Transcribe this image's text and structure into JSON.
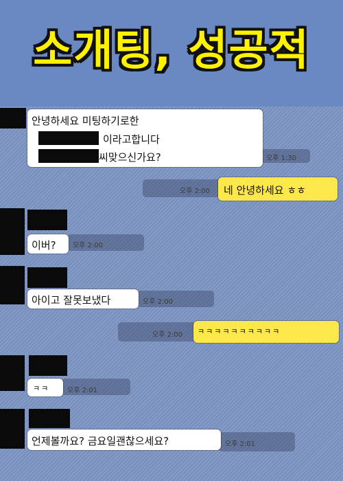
{
  "header": {
    "title": "소개팅, 성공적"
  },
  "messages": [
    {
      "side": "received",
      "lines": [
        "안녕하세요 미팅하기로한",
        "이라고합니다",
        "씨맞으신가요?"
      ],
      "time": "오후 1:30"
    },
    {
      "side": "sent",
      "lines": [
        "네 안녕하세요 ㅎㅎ"
      ],
      "time": "오후 2:00"
    },
    {
      "side": "received",
      "lines": [
        "이버?"
      ],
      "time": "오후 2:00"
    },
    {
      "side": "received",
      "lines": [
        "아이고 잘못보냈다"
      ],
      "time": "오후 2:00"
    },
    {
      "side": "sent",
      "lines": [
        "ㅋㅋㅋㅋㅋㅋㅋㅋㅋㅋ"
      ],
      "time": "오후 2:00"
    },
    {
      "side": "received",
      "lines": [
        "ㅋㅋ"
      ],
      "time": "오후 2:01"
    },
    {
      "side": "received",
      "lines": [
        "언제볼까요? 금요일괜찮으세요?"
      ],
      "time": "오후 2:01"
    }
  ],
  "colors": {
    "background": "#6a88c2",
    "title": "#fff200",
    "sent_bubble": "#fce84a",
    "received_bubble": "#ffffff",
    "redaction": "#0a0a0a"
  }
}
